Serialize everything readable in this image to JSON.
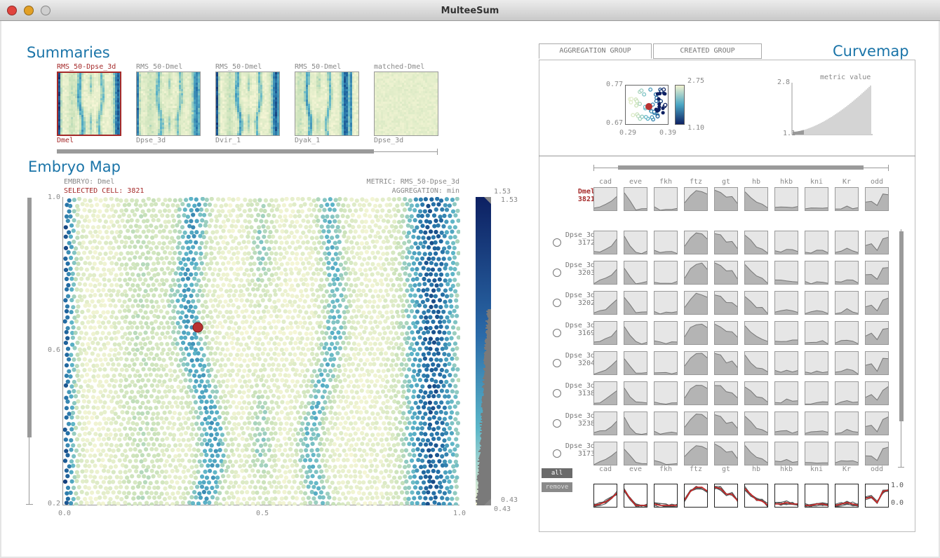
{
  "window": {
    "title": "MulteeSum"
  },
  "summaries": {
    "heading": "Summaries",
    "thumbs": [
      {
        "top": "RMS_50-Dpse_3d",
        "bottom": "Dmel",
        "selected": true
      },
      {
        "top": "RMS_50-Dmel",
        "bottom": "Dpse_3d",
        "selected": false
      },
      {
        "top": "RMS_50-Dmel",
        "bottom": "Dvir_1",
        "selected": false
      },
      {
        "top": "RMS_50-Dmel",
        "bottom": "Dyak_1",
        "selected": false
      },
      {
        "top": "matched-Dmel",
        "bottom": "Dpse_3d",
        "selected": false
      }
    ]
  },
  "embryo_map": {
    "heading": "Embryo Map",
    "embryo_label": "EMBRYO: Dmel",
    "selected_cell_label": "SELECTED CELL: 3821",
    "metric_label": "METRIC: RMS_50-Dpse_3d",
    "aggregation_label": "AGGREGATION: min",
    "y_ticks": [
      "1.0",
      "0.6",
      "0.2"
    ],
    "x_ticks": [
      "0.0",
      "0.5",
      "1.0"
    ],
    "colorbar_max": "1.53",
    "colorbar_min": "0.43",
    "colorbar_max_handle": "1.53",
    "colorbar_min_handle": "0.43"
  },
  "curvemap": {
    "heading": "Curvemap",
    "tabs": [
      "AGGREGATION GROUP",
      "CREATED GROUP"
    ],
    "scatter": {
      "y_max": "0.77",
      "y_min": "0.67",
      "x_min": "0.29",
      "x_max": "0.39",
      "c_max": "2.75",
      "c_min": "1.10"
    },
    "metric": {
      "title": "metric value",
      "y_max": "2.8",
      "y_min": "1.1"
    },
    "genes": [
      "cad",
      "eve",
      "fkh",
      "ftz",
      "gt",
      "hb",
      "hkb",
      "kni",
      "Kr",
      "odd"
    ],
    "ref_row": {
      "name": "Dmel",
      "id": "3821"
    },
    "rows": [
      {
        "name": "Dpse_3d",
        "id": "3172"
      },
      {
        "name": "Dpse_3d",
        "id": "3203"
      },
      {
        "name": "Dpse_3d",
        "id": "3202"
      },
      {
        "name": "Dpse_3d",
        "id": "3169"
      },
      {
        "name": "Dpse_3d",
        "id": "3204"
      },
      {
        "name": "Dpse_3d",
        "id": "3138"
      },
      {
        "name": "Dpse_3d",
        "id": "3238"
      },
      {
        "name": "Dpse_3d",
        "id": "3173"
      }
    ],
    "buttons": {
      "all": "all",
      "remove": "remove"
    },
    "summary_y_max": "1.0",
    "summary_y_min": "0.0"
  },
  "colors": {
    "accent": "#1a74a8",
    "selected": "#a52a2a",
    "dot_low": "#f4f4d4",
    "dot_high": "#0a1f5c"
  }
}
